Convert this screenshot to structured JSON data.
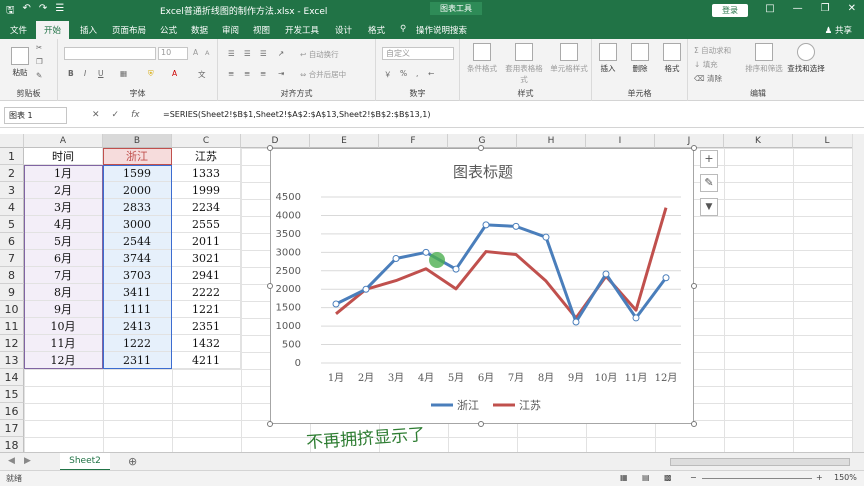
{
  "window": {
    "title": "Excel普通折线图的制作方法.xlsx  -  Excel",
    "context_tool": "图表工具",
    "signin": "登录",
    "share": "共享"
  },
  "tabs": [
    "文件",
    "开始",
    "插入",
    "页面布局",
    "公式",
    "数据",
    "审阅",
    "视图",
    "开发工具",
    "设计",
    "格式",
    "操作说明搜索"
  ],
  "ribbon": {
    "clipboard": {
      "label": "剪贴板",
      "paste": "粘贴"
    },
    "font": {
      "label": "字体",
      "size": "10",
      "grow": "A",
      "shrink": "A",
      "bold": "B",
      "italic": "I",
      "underline": "U"
    },
    "alignment": {
      "label": "对齐方式",
      "wrap": "自动换行",
      "merge": "合并后居中"
    },
    "number": {
      "label": "数字",
      "format": "自定义"
    },
    "styles": {
      "label": "样式",
      "cond": "条件格式",
      "table": "套用表格格式",
      "cell": "单元格样式"
    },
    "cells": {
      "label": "单元格",
      "insert": "插入",
      "delete": "删除",
      "format": "格式"
    },
    "editing": {
      "label": "编辑",
      "autosum": "自动求和",
      "fill": "填充",
      "clear": "清除",
      "sort": "排序和筛选",
      "find": "查找和选择"
    }
  },
  "formula_bar": {
    "name_box": "图表 1",
    "cancel": "✕",
    "enter": "✓",
    "fx": "fx",
    "formula": "=SERIES(Sheet2!$B$1,Sheet2!$A$2:$A$13,Sheet2!$B$2:$B$13,1)"
  },
  "columns": [
    "A",
    "B",
    "C",
    "D",
    "E",
    "F",
    "G",
    "H",
    "I",
    "J",
    "K",
    "L"
  ],
  "rows": [
    "1",
    "2",
    "3",
    "4",
    "5",
    "6",
    "7",
    "8",
    "9",
    "10",
    "11",
    "12",
    "13",
    "14",
    "15",
    "16",
    "17",
    "18"
  ],
  "table": {
    "headers": [
      "时间",
      "浙江",
      "江苏"
    ],
    "rows": [
      [
        "1月",
        "1599",
        "1333"
      ],
      [
        "2月",
        "2000",
        "1999"
      ],
      [
        "3月",
        "2833",
        "2234"
      ],
      [
        "4月",
        "3000",
        "2555"
      ],
      [
        "5月",
        "2544",
        "2011"
      ],
      [
        "6月",
        "3744",
        "3021"
      ],
      [
        "7月",
        "3703",
        "2941"
      ],
      [
        "8月",
        "3411",
        "2222"
      ],
      [
        "9月",
        "1111",
        "1221"
      ],
      [
        "10月",
        "2413",
        "2351"
      ],
      [
        "11月",
        "1222",
        "1432"
      ],
      [
        "12月",
        "2311",
        "4211"
      ]
    ]
  },
  "chart_data": {
    "type": "line",
    "title": "图表标题",
    "categories": [
      "1月",
      "2月",
      "3月",
      "4月",
      "5月",
      "6月",
      "7月",
      "8月",
      "9月",
      "10月",
      "11月",
      "12月"
    ],
    "series": [
      {
        "name": "浙江",
        "color": "#4a7ebb",
        "values": [
          1599,
          2000,
          2833,
          3000,
          2544,
          3744,
          3703,
          3411,
          1111,
          2413,
          1222,
          2311
        ]
      },
      {
        "name": "江苏",
        "color": "#c0504d",
        "values": [
          1333,
          1999,
          2234,
          2555,
          2011,
          3021,
          2941,
          2222,
          1221,
          2351,
          1432,
          4211
        ]
      }
    ],
    "yticks": [
      "0",
      "500",
      "1000",
      "1500",
      "2000",
      "2500",
      "3000",
      "3500",
      "4000",
      "4500"
    ],
    "ylim": [
      0,
      4500
    ],
    "grid": true,
    "legend": "bottom"
  },
  "chart_buttons": {
    "add": "+",
    "style": "✎",
    "filter": "▼"
  },
  "caption": "不再拥挤显示了",
  "sheet_tab": "Sheet2",
  "status": {
    "ready": "就绪",
    "zoom": "150%"
  }
}
